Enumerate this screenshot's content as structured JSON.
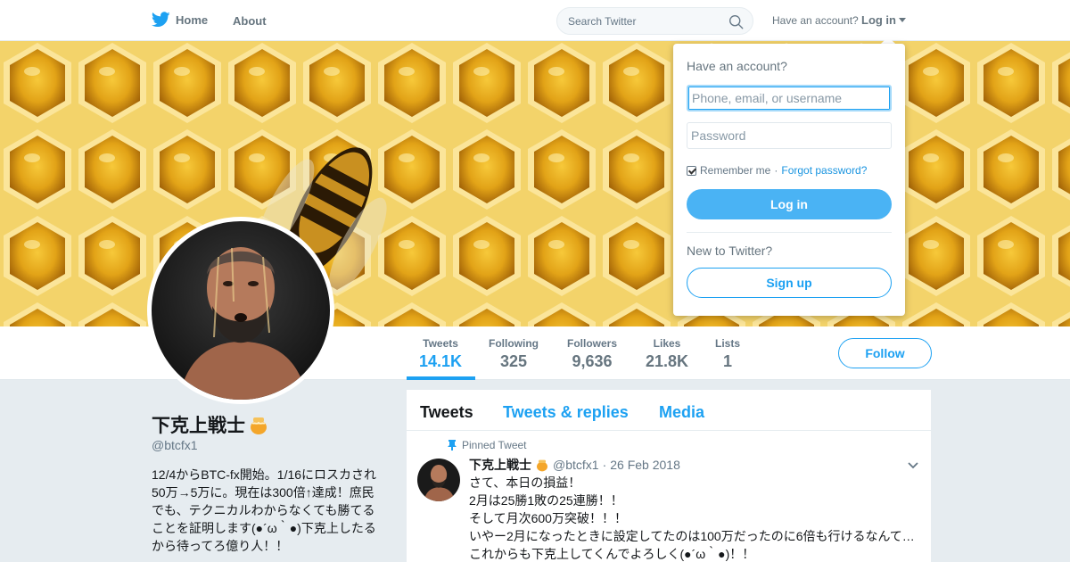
{
  "nav": {
    "home_label": "Home",
    "about_label": "About",
    "search_placeholder": "Search Twitter",
    "have_account_text": "Have an account?",
    "login_toggle_label": "Log in"
  },
  "profile": {
    "name": "下克上戦士",
    "handle": "@btcfx1",
    "bio_lines": [
      "12/4からBTC-fx開始。1/16にロスカされ",
      "50万→5万に。現在は300倍↑達成！庶民",
      "でも、テクニカルわからなくても勝てる",
      "ことを証明します(●´ω｀●)下克上したる",
      "から待ってろ億り人！！"
    ],
    "follow_label": "Follow"
  },
  "stats": [
    {
      "label": "Tweets",
      "value": "14.1K"
    },
    {
      "label": "Following",
      "value": "325"
    },
    {
      "label": "Followers",
      "value": "9,636"
    },
    {
      "label": "Likes",
      "value": "21.8K"
    },
    {
      "label": "Lists",
      "value": "1"
    }
  ],
  "timeline": {
    "tabs": [
      "Tweets",
      "Tweets & replies",
      "Media"
    ],
    "pinned_label": "Pinned Tweet",
    "tweet": {
      "name": "下克上戦士",
      "handle": "@btcfx1",
      "separator": "·",
      "date": "26 Feb 2018",
      "lines": [
        "さて、本日の損益！",
        "2月は25勝1敗の25連勝！！",
        "そして月次600万突破！！！",
        "いやー2月になったときに設定してたのは100万だったのに6倍も行けるなんて…",
        "これからも下克上してくんでよろしく(●´ω｀●)！！"
      ]
    }
  },
  "login_dropdown": {
    "heading": "Have an account?",
    "username_placeholder": "Phone, email, or username",
    "password_placeholder": "Password",
    "remember_label": "Remember me",
    "separator": "·",
    "forgot_label": "Forgot password?",
    "login_button": "Log in",
    "new_to_twitter": "New to Twitter?",
    "signup_button": "Sign up"
  },
  "colors": {
    "accent": "#1da1f2",
    "background": "#e6ecf0",
    "banner_honey": "#d79a14"
  },
  "icons": [
    "twitter-bird-icon",
    "search-icon",
    "caret-down-icon",
    "honey-pot-icon",
    "pin-icon",
    "chevron-down-icon",
    "checkbox-icon"
  ]
}
